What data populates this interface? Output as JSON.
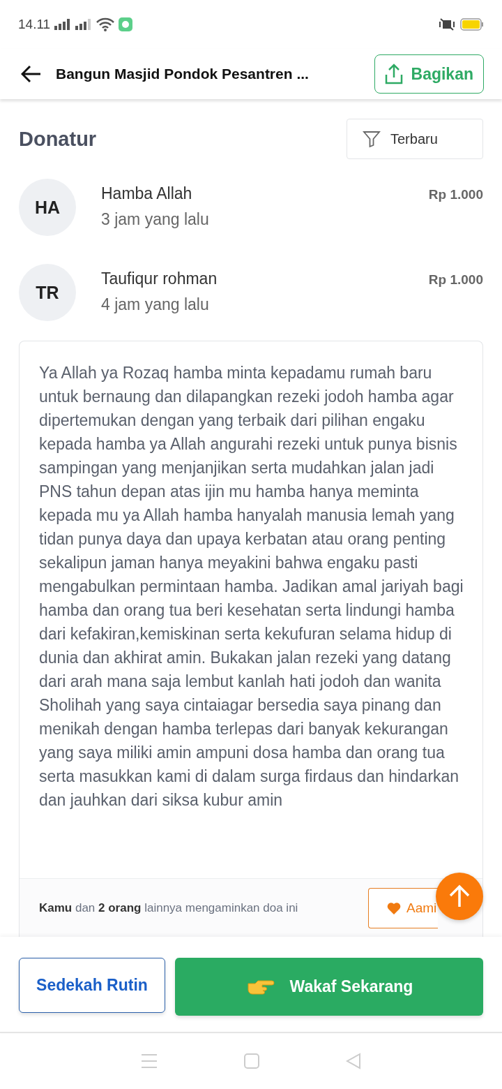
{
  "status_bar": {
    "time": "14.11"
  },
  "header": {
    "title": "Bangun Masjid Pondok Pesantren ...",
    "share_label": "Bagikan"
  },
  "donors_section": {
    "title": "Donatur",
    "filter_label": "Terbaru"
  },
  "donors": [
    {
      "initials": "HA",
      "name": "Hamba Allah",
      "time": "3 jam yang lalu",
      "amount": "Rp 1.000"
    },
    {
      "initials": "TR",
      "name": "Taufiqur rohman",
      "time": "4 jam yang lalu",
      "amount": "Rp 1.000"
    }
  ],
  "prayer_card": {
    "message": "Ya Allah ya Rozaq hamba minta kepadamu rumah baru untuk bernaung dan dilapangkan rezeki jodoh hamba agar dipertemukan dengan yang terbaik dari pilihan engaku kepada hamba ya Allah angurahi rezeki untuk punya bisnis sampingan yang menjanjikan serta mudahkan jalan jadi PNS tahun depan atas ijin mu hamba hanya meminta kepada mu ya Allah hamba hanyalah manusia lemah yang tidan punya daya dan upaya kerbatan atau orang penting sekalipun jaman hanya meyakini bahwa engaku pasti mengabulkan permintaan hamba. Jadikan amal jariyah bagi hamba dan orang tua beri kesehatan serta lindungi hamba dari kefakiran,kemiskinan serta kekufuran selama hidup di dunia dan akhirat amin. Bukakan jalan rezeki yang datang dari arah mana saja lembut kanlah hati jodoh dan wanita Sholihah yang saya cintaiagar bersedia saya pinang dan menikah dengan hamba terlepas dari banyak kekurangan yang saya miliki amin ampuni dosa hamba dan orang tua serta masukkan kami di dalam surga firdaus dan hindarkan dan jauhkan dari siksa kubur amin",
    "amen_text": "**Kamu** dan **2 orang** lainnya mengaminkan doa ini",
    "amen_button": "Aami"
  },
  "actions": {
    "secondary": "Sedekah Rutin",
    "primary": "Wakaf Sekarang"
  }
}
